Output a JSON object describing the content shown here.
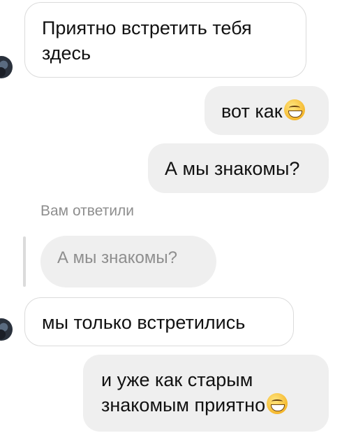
{
  "messages": [
    {
      "direction": "incoming",
      "lines": [
        "Приятно встретить тебя",
        "здесь"
      ]
    },
    {
      "direction": "outgoing",
      "text": "вот как",
      "emoji": "grinning-face-emoji"
    },
    {
      "direction": "outgoing",
      "text": "А мы знакомы?"
    },
    {
      "reply_label": "Вам ответили",
      "quoted_text": "А мы знакомы?"
    },
    {
      "direction": "incoming",
      "text": "мы только встретились"
    },
    {
      "direction": "outgoing",
      "lines": [
        "и уже как старым",
        "знакомым приятно"
      ],
      "emoji": "grinning-face-emoji"
    }
  ],
  "colors": {
    "incoming_bubble_border": "#dbdbdb",
    "outgoing_bubble_bg": "#efefef",
    "reply_text": "#8e8e8e"
  }
}
